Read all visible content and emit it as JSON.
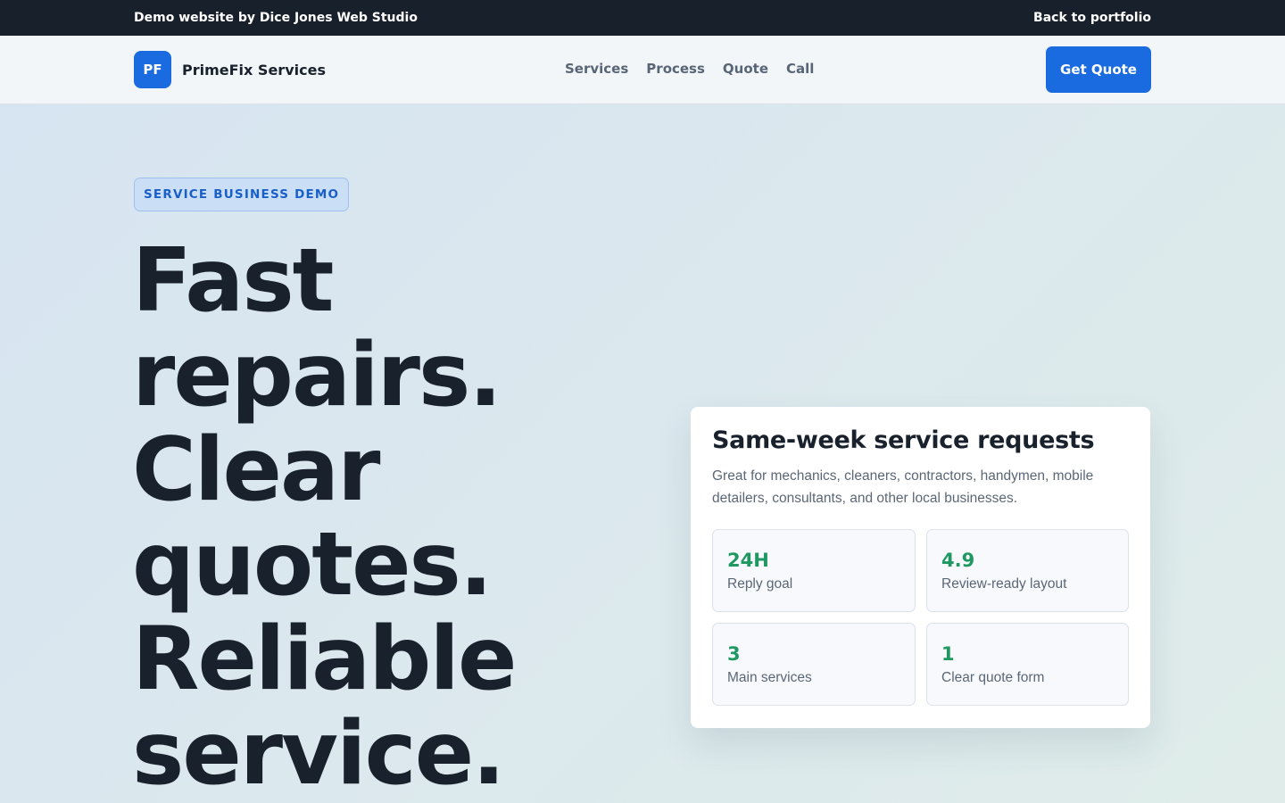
{
  "topbar": {
    "credit": "Demo website by Dice Jones Web Studio",
    "back_link": "Back to portfolio"
  },
  "navbar": {
    "logo_initials": "PF",
    "brand_name": "PrimeFix Services",
    "links": [
      "Services",
      "Process",
      "Quote",
      "Call"
    ],
    "cta_label": "Get Quote"
  },
  "hero": {
    "badge": "SERVICE BUSINESS DEMO",
    "title_lines": [
      "Fast",
      "repairs.",
      "Clear",
      "quotes.",
      "Reliable",
      "service."
    ]
  },
  "card": {
    "title": "Same-week service requests",
    "description": "Great for mechanics, cleaners, contractors, handymen, mobile detailers, consultants, and other local businesses.",
    "stats": [
      {
        "value": "24H",
        "label": "Reply goal"
      },
      {
        "value": "4.9",
        "label": "Review-ready layout"
      },
      {
        "value": "3",
        "label": "Main services"
      },
      {
        "value": "1",
        "label": "Clear quote form"
      }
    ]
  },
  "colors": {
    "topbar_bg": "#18202b",
    "accent": "#1a6be0",
    "stat_green": "#1f9961",
    "badge_bg": "#cadff6"
  }
}
